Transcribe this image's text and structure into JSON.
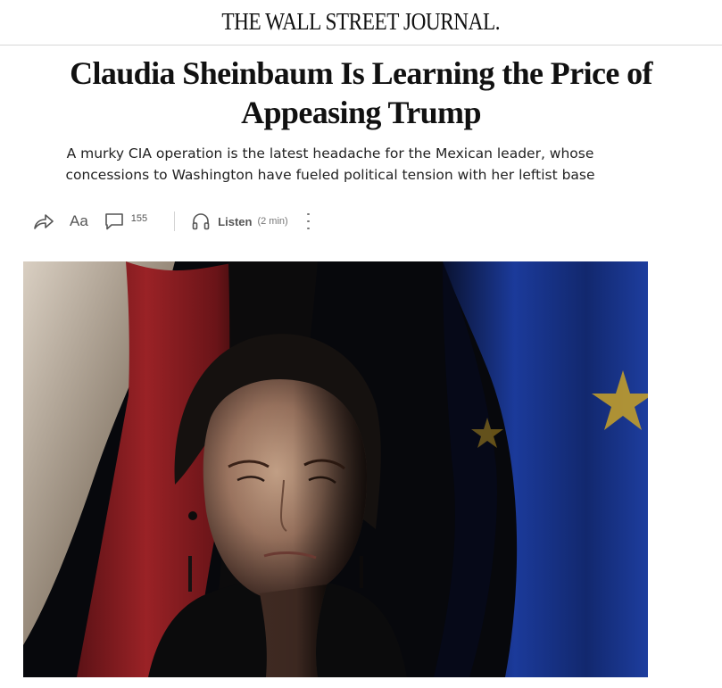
{
  "masthead": {
    "title": "THE WALL STREET JOURNAL."
  },
  "article": {
    "headline": "Claudia Sheinbaum Is Learning the Price of Appeasing Trump",
    "dek": "A murky CIA operation is the latest headache for the Mexican leader, whose concessions to Washington have fueled political tension with her leftist base"
  },
  "toolbar": {
    "share_icon": "share-icon",
    "font_size_label": "Aa",
    "comment_icon": "comment-icon",
    "comment_count": "155",
    "listen_icon": "headphones-icon",
    "listen_label": "Listen",
    "listen_duration": "(2 min)",
    "more_icon": "more-vertical-icon"
  },
  "hero_image": {
    "subject": "portrait",
    "colors": {
      "background": "#07080c",
      "flag_red": "#7a1a1e",
      "flag_blue": "#1b3a9a",
      "star_gold": "#c9a227"
    }
  }
}
